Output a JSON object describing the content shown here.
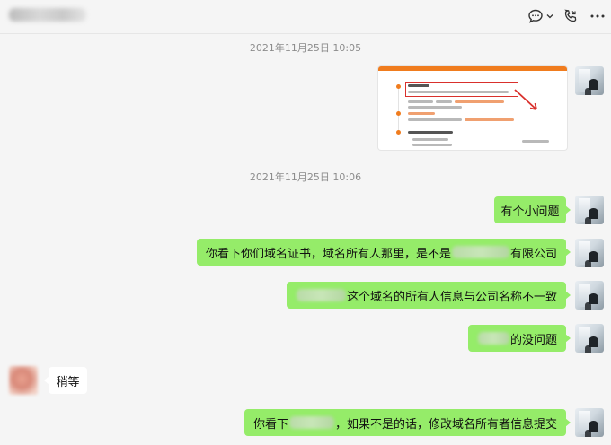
{
  "header": {
    "icons": [
      "chat-bubble-icon",
      "chevron-down-icon",
      "phone-icon",
      "more-icon"
    ]
  },
  "messages": {
    "ts1": "2021年11月25日 10:05",
    "ts2": "2021年11月25日 10:06",
    "m1": "有个小问题",
    "m2_prefix": "你看下你们域名证书，域名所有人那里，是不是",
    "m2_suffix": "有限公司",
    "m3_suffix": "这个域名的所有人信息与公司名称不一致",
    "m4_suffix": "的没问题",
    "m5": "稍等",
    "m6_prefix": "你看下",
    "m6_suffix": "，如果不是的话，修改域名所有者信息提交"
  },
  "colors": {
    "self_bubble": "#95ec69",
    "other_bubble": "#ffffff",
    "background": "#f5f5f5",
    "timestamp": "#8c8c8c"
  }
}
